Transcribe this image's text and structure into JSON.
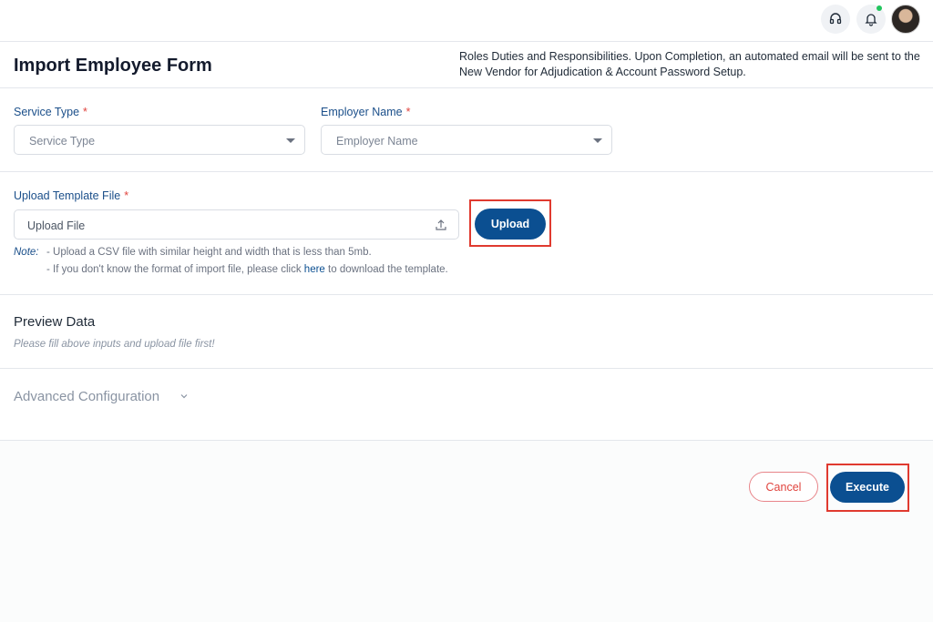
{
  "form": {
    "title": "Import Employee Form",
    "header_note": "Roles Duties and Responsibilities. Upon Completion, an automated email will be sent to the New Vendor for Adjudication & Account Password Setup.",
    "required_mark": "*",
    "service_type": {
      "label": "Service Type",
      "placeholder": "Service Type"
    },
    "employer_name": {
      "label": "Employer Name",
      "placeholder": "Employer Name"
    },
    "upload": {
      "label": "Upload Template File",
      "placeholder": "Upload File",
      "button_label": "Upload",
      "note_label": "Note:",
      "note_line1": "- Upload a CSV file with similar height and width that is less than 5mb.",
      "note_line2_prefix": "- If you don't know the format of import file, please click",
      "note_link": "here",
      "note_line2_suffix": "to download the template."
    },
    "preview": {
      "title": "Preview Data",
      "hint": "Please fill above inputs and upload file first!"
    },
    "advanced": {
      "title": "Advanced Configuration"
    },
    "actions": {
      "cancel_label": "Cancel",
      "execute_label": "Execute"
    }
  },
  "icons": [
    "headset-icon",
    "bell-icon",
    "avatar",
    "caret-down-icon",
    "upload-icon",
    "chevron-down-icon"
  ],
  "colors": {
    "primary": "#0b4f91",
    "label": "#1b4f8a",
    "required": "#e0443e",
    "highlight": "#e03a2f",
    "online": "#22c55e"
  }
}
